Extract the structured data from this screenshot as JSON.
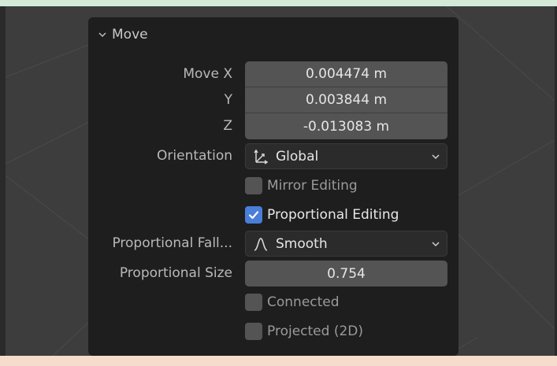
{
  "panel": {
    "title": "Move",
    "move_x": {
      "label": "Move X",
      "value": "0.004474 m"
    },
    "move_y": {
      "label": "Y",
      "value": "0.003844 m"
    },
    "move_z": {
      "label": "Z",
      "value": "-0.013083 m"
    },
    "orientation": {
      "label": "Orientation",
      "value": "Global"
    },
    "mirror_editing": {
      "label": "Mirror Editing",
      "checked": false
    },
    "proportional_editing": {
      "label": "Proportional Editing",
      "checked": true
    },
    "proportional_falloff": {
      "label": "Proportional Fall...",
      "value": "Smooth"
    },
    "proportional_size": {
      "label": "Proportional Size",
      "value": "0.754"
    },
    "connected": {
      "label": "Connected",
      "checked": false
    },
    "projected": {
      "label": "Projected (2D)",
      "checked": false
    }
  },
  "colors": {
    "panel_bg": "#1e1e1e",
    "field_bg": "#545454",
    "checkbox_on": "#4a7ed9"
  },
  "icons": {
    "collapse": "chevron-down-icon",
    "orientation": "orientation-axes-icon",
    "falloff": "smooth-falloff-icon",
    "dropdown": "dropdown-caret-icon",
    "check": "checkmark-icon"
  }
}
